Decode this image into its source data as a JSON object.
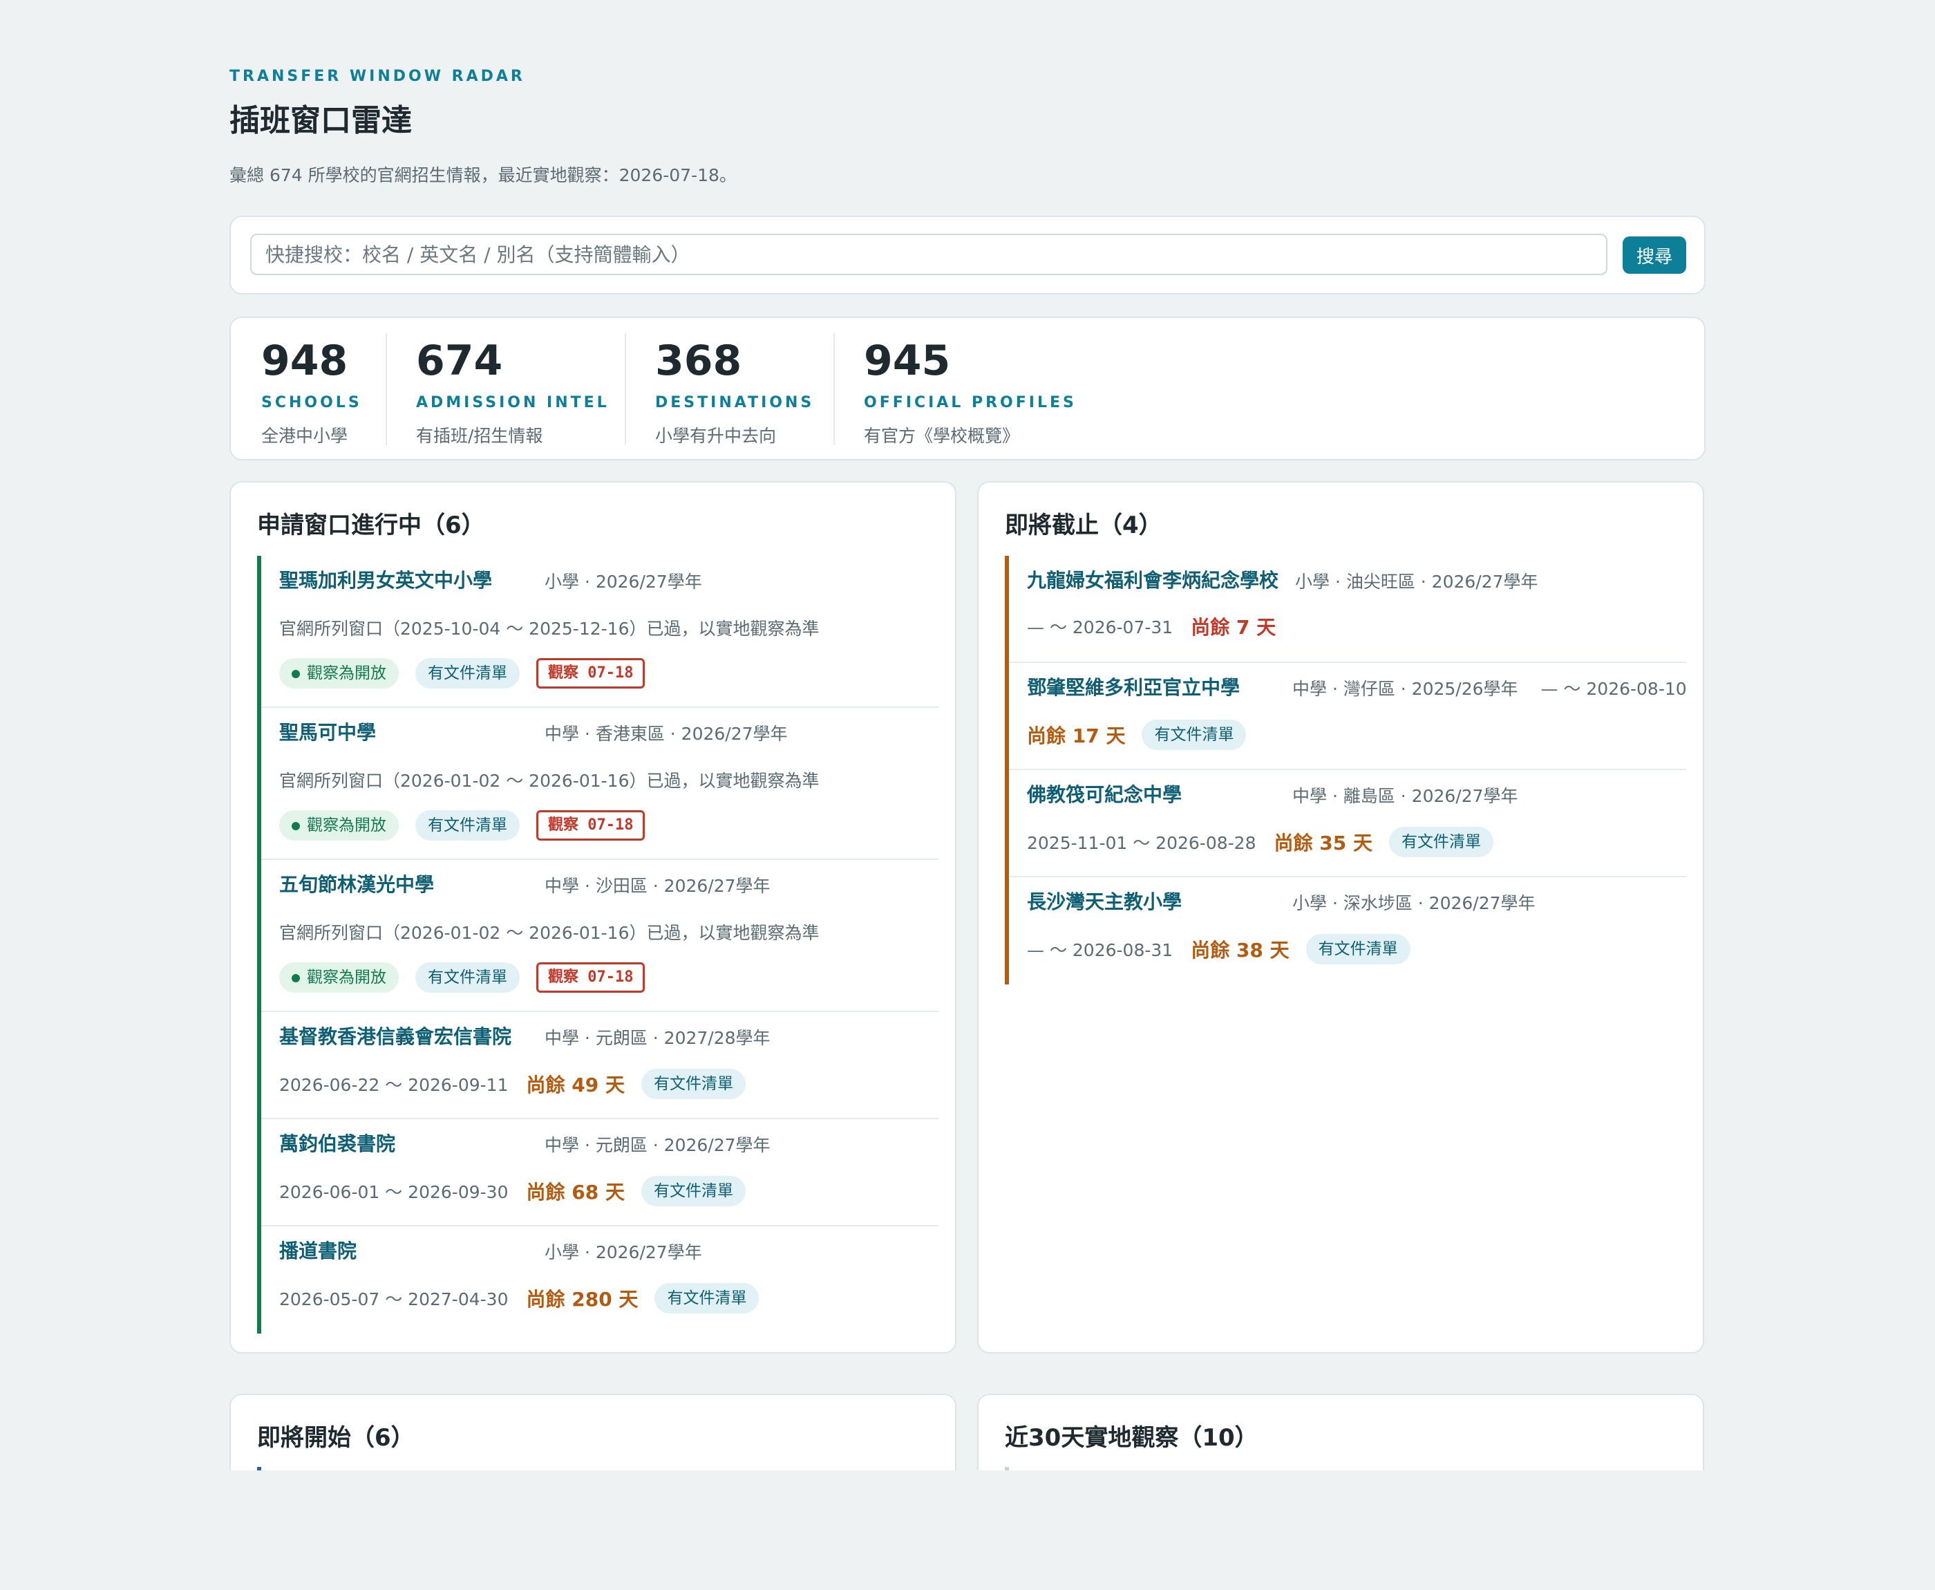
{
  "header": {
    "eyebrow": "TRANSFER WINDOW RADAR",
    "title": "插班窗口雷達",
    "subtitle": "彙總 674 所學校的官網招生情報，最近實地觀察：2026-07-18。"
  },
  "search": {
    "placeholder": "快捷搜校：校名 / 英文名 / 別名（支持簡體輸入）",
    "value": "",
    "button_label": "搜尋"
  },
  "stats": [
    {
      "value": "948",
      "label": "SCHOOLS",
      "desc": "全港中小學"
    },
    {
      "value": "674",
      "label": "ADMISSION INTEL",
      "desc": "有插班/招生情報"
    },
    {
      "value": "368",
      "label": "DESTINATIONS",
      "desc": "小學有升中去向"
    },
    {
      "value": "945",
      "label": "OFFICIAL PROFILES",
      "desc": "有官方《學校概覽》"
    }
  ],
  "open_now": {
    "title": "申請窗口進行中（6）",
    "items": [
      {
        "name": "聖瑪加利男女英文中小學",
        "meta": "小學 · 2026/27學年",
        "note": "官網所列窗口（2025-10-04 〜 2025-12-16）已過，以實地觀察為準",
        "status": "觀察為開放",
        "doc": "有文件清單",
        "observed": "觀察 07-18"
      },
      {
        "name": "聖馬可中學",
        "meta": "中學 · 香港東區 · 2026/27學年",
        "note": "官網所列窗口（2026-01-02 〜 2026-01-16）已過，以實地觀察為準",
        "status": "觀察為開放",
        "doc": "有文件清單",
        "observed": "觀察 07-18"
      },
      {
        "name": "五旬節林漢光中學",
        "meta": "中學 · 沙田區 · 2026/27學年",
        "note": "官網所列窗口（2026-01-02 〜 2026-01-16）已過，以實地觀察為準",
        "status": "觀察為開放",
        "doc": "有文件清單",
        "observed": "觀察 07-18"
      },
      {
        "name": "基督教香港信義會宏信書院",
        "meta": "中學 · 元朗區 · 2027/28學年",
        "range": "2026-06-22 〜 2026-09-11",
        "remain": "尚餘 49 天",
        "doc": "有文件清單"
      },
      {
        "name": "萬鈞伯裘書院",
        "meta": "中學 · 元朗區 · 2026/27學年",
        "range": "2026-06-01 〜 2026-09-30",
        "remain": "尚餘 68 天",
        "doc": "有文件清單"
      },
      {
        "name": "播道書院",
        "meta": "小學 · 2026/27學年",
        "range": "2026-05-07 〜 2027-04-30",
        "remain": "尚餘 280 天",
        "doc": "有文件清單"
      }
    ]
  },
  "closing_soon": {
    "title": "即將截止（4）",
    "items": [
      {
        "name": "九龍婦女福利會李炳紀念學校",
        "meta": "小學 · 油尖旺區 · 2026/27學年",
        "range": "— 〜 2026-07-31",
        "remain": "尚餘 7 天",
        "urgent": true,
        "doc": ""
      },
      {
        "name": "鄧肇堅維多利亞官立中學",
        "meta": "中學 · 灣仔區 · 2025/26學年 　— 〜 2026-08-10",
        "range": "",
        "remain": "尚餘 17 天",
        "doc": "有文件清單"
      },
      {
        "name": "佛教筏可紀念中學",
        "meta": "中學 · 離島區 · 2026/27學年",
        "range": "2025-11-01 〜 2026-08-28",
        "remain": "尚餘 35 天",
        "doc": "有文件清單"
      },
      {
        "name": "長沙灣天主教小學",
        "meta": "小學 · 深水埗區 · 2026/27學年",
        "range": "— 〜 2026-08-31",
        "remain": "尚餘 38 天",
        "doc": "有文件清單"
      }
    ]
  },
  "upcoming": {
    "title": "即將開始（6）"
  },
  "recent": {
    "title": "近30天實地觀察（10）"
  }
}
